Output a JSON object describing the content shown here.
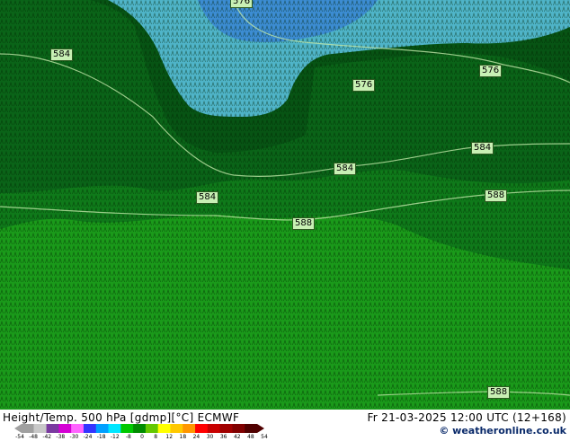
{
  "map": {
    "contour_labels": [
      "576",
      "584",
      "576",
      "576",
      "584",
      "584",
      "584",
      "588",
      "588",
      "588"
    ]
  },
  "footer": {
    "title": "Height/Temp. 500 hPa [gdmp][°C] ECMWF",
    "valid": "Fr 21-03-2025 12:00 UTC (12+168)",
    "credit": "© weatheronline.co.uk"
  },
  "legend": {
    "ticks": [
      "-54",
      "-48",
      "-42",
      "-38",
      "-30",
      "-24",
      "-18",
      "-12",
      "-8",
      "0",
      "8",
      "12",
      "18",
      "24",
      "30",
      "36",
      "42",
      "48",
      "54"
    ],
    "colors": [
      "#a0a0a0",
      "#c8c8c8",
      "#7a3aa0",
      "#d400d4",
      "#ff64ff",
      "#3434ff",
      "#00a0ff",
      "#00e6ff",
      "#00c800",
      "#008c00",
      "#64c800",
      "#ffff00",
      "#ffc800",
      "#ff9600",
      "#ff0000",
      "#c80000",
      "#a00000",
      "#800000",
      "#500000"
    ]
  }
}
